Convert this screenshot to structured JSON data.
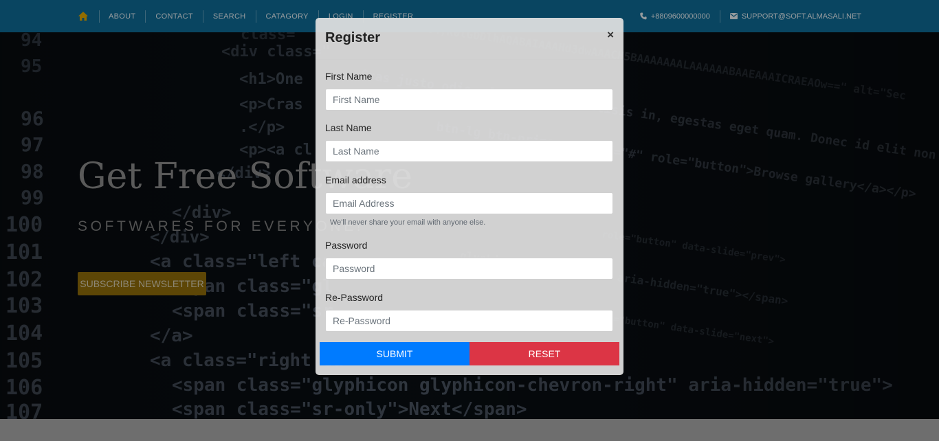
{
  "nav": {
    "home_icon": "home-icon",
    "items": [
      "ABOUT",
      "CONTACT",
      "SEARCH",
      "CATAGORY",
      "LOGIN",
      "REGISTER"
    ],
    "phone": "+8809600000000",
    "phone_icon": "phone-icon",
    "email": "SUPPORT@SOFT.ALMASALI.NET",
    "email_icon": "envelope-icon"
  },
  "hero": {
    "title": "Get Free Software",
    "subtitle": "SOFTWARES FOR EVERYONE!",
    "button": "SUBSCRIBE NEWSLETTER"
  },
  "modal": {
    "title": "Register",
    "close": "×",
    "fields": [
      {
        "label": "First Name",
        "placeholder": "First Name"
      },
      {
        "label": "Last Name",
        "placeholder": "Last Name"
      },
      {
        "label": "Email address",
        "placeholder": "Email Address"
      },
      {
        "label": "Password",
        "placeholder": "Password"
      },
      {
        "label": "Re-Password",
        "placeholder": "Re-Password"
      }
    ],
    "email_help": "We'll never share your email with anyone else.",
    "submit": "SUBMIT",
    "reset": "RESET"
  },
  "colors": {
    "topbar": "#0e6b95",
    "home_icon": "#e0a800",
    "subscribe_button": "#8f6c0a",
    "submit_button": "#007bff",
    "reset_button": "#dc3545"
  }
}
